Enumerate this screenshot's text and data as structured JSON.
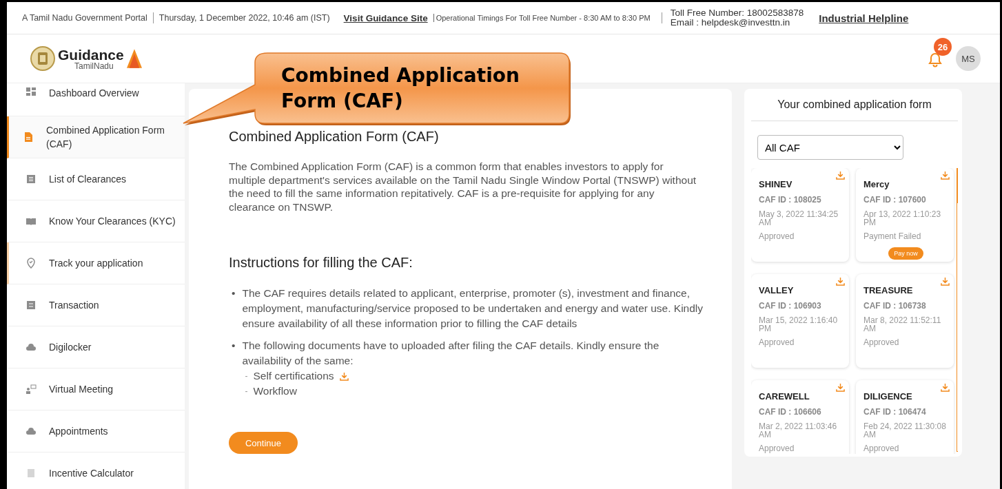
{
  "top_bar": {
    "portal": "A Tamil Nadu Government Portal",
    "date": "Thursday, 1 December 2022, 10:46 am (IST)",
    "guidance_link": "Visit Guidance Site",
    "timings": "Operational Timings For Toll Free Number - 8:30 AM to 8:30 PM",
    "toll_free": "Toll Free Number: 18002583878",
    "email": "Email : helpdesk@investtn.in",
    "helpline_link": "Industrial Helpline"
  },
  "header": {
    "logo_title": "Guidance",
    "logo_subtitle": "TamilNadu",
    "notification_count": "26",
    "avatar": "MS"
  },
  "callout": {
    "text": "Combined Application Form (CAF)"
  },
  "sidebar": {
    "items": [
      {
        "label": "Dashboard Overview",
        "selected": false,
        "hovered": false
      },
      {
        "label": "Combined Application Form (CAF)",
        "selected": true,
        "hovered": false
      },
      {
        "label": "List of Clearances",
        "selected": false,
        "hovered": false
      },
      {
        "label": "Know Your Clearances (KYC)",
        "selected": false,
        "hovered": false
      },
      {
        "label": "Track your application",
        "selected": false,
        "hovered": true
      },
      {
        "label": "Transaction",
        "selected": false,
        "hovered": false
      },
      {
        "label": "Digilocker",
        "selected": false,
        "hovered": false
      },
      {
        "label": "Virtual Meeting",
        "selected": false,
        "hovered": false
      },
      {
        "label": "Appointments",
        "selected": false,
        "hovered": false
      },
      {
        "label": "Incentive Calculator",
        "selected": false,
        "hovered": false
      }
    ]
  },
  "main": {
    "heading": "Combined Application Form (CAF)",
    "intro": "The Combined Application Form (CAF) is a common form that enables investors to apply for multiple department's services available on the Tamil Nadu Single Window Portal (TNSWP) without the need to fill the same information repitatively. CAF is a pre-requisite for applying for any clearance on TNSWP.",
    "instructions_heading": "Instructions for filling the CAF:",
    "instructions": [
      {
        "marker": "•",
        "text": "The CAF requires details related to applicant, enterprise, promoter (s), investment and finance, employment, manufacturing/service proposed to be undertaken and energy and water use. Kindly ensure availability of all these information prior to filling the CAF details"
      },
      {
        "marker": "•",
        "text": "The following documents have to uploaded after filing the CAF details. Kindly ensure the availability of the same:",
        "documents": [
          {
            "marker": "-",
            "label": "Self certifications",
            "download": true
          },
          {
            "marker": "-",
            "label": "Workflow",
            "download": false
          }
        ]
      }
    ],
    "continue_button": "Continue"
  },
  "right_panel": {
    "title": "Your combined application form",
    "filter": "All CAF",
    "cards": [
      {
        "name": "SHINEV",
        "caf_id": "CAF ID : 108025",
        "date": "May 3, 2022 11:34:25 AM",
        "status": "Approved"
      },
      {
        "name": "Mercy",
        "caf_id": "CAF ID : 107600",
        "date": "Apr 13, 2022 1:10:23 PM",
        "status": "Payment Failed",
        "action": "Pay now"
      },
      {
        "name": "VALLEY",
        "caf_id": "CAF ID : 106903",
        "date": "Mar 15, 2022 1:16:40 PM",
        "status": "Approved"
      },
      {
        "name": "TREASURE",
        "caf_id": "CAF ID : 106738",
        "date": "Mar 8, 2022 11:52:11 AM",
        "status": "Approved"
      },
      {
        "name": "CAREWELL",
        "caf_id": "CAF ID : 106606",
        "date": "Mar 2, 2022 11:03:46 AM",
        "status": "Approved"
      },
      {
        "name": "DILIGENCE",
        "caf_id": "CAF ID : 106474",
        "date": "Feb 24, 2022 11:30:08 AM",
        "status": "Approved"
      }
    ]
  }
}
